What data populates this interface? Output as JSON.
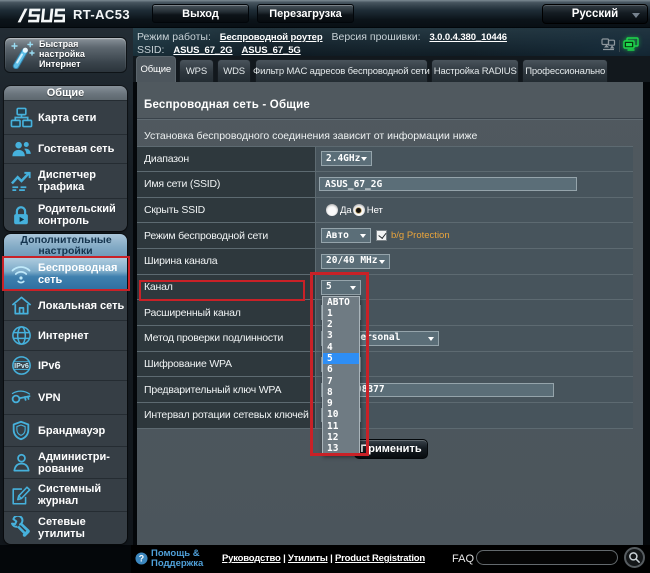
{
  "topbar": {
    "brand": "ASUS",
    "model": "RT-AC53",
    "logout_label": "Выход",
    "reboot_label": "Перезагрузка",
    "language": {
      "value": "Русский"
    }
  },
  "infobar": {
    "mode_label": "Режим работы:",
    "mode_link": "Беспроводной роутер",
    "firmware_label": "Версия прошивки:",
    "firmware_link": "3.0.0.4.380_10446",
    "ssid_label": "SSID:",
    "ssid_links": [
      "ASUS_67_2G",
      "ASUS_67_5G"
    ],
    "icons": [
      "clients-icon",
      "network-status-icon"
    ]
  },
  "tabs": [
    {
      "label": "Общие",
      "active": true
    },
    {
      "label": "WPS",
      "active": false
    },
    {
      "label": "WDS",
      "active": false
    },
    {
      "label": "Фильтр MAC адресов беспроводной сети",
      "active": false
    },
    {
      "label": "Настройка RADIUS",
      "active": false
    },
    {
      "label": "Профессионально",
      "active": false
    }
  ],
  "sidebar": {
    "qis_label_line1": "Быстрая",
    "qis_label_line2": "настройка",
    "qis_label_line3": "Интернет",
    "sections": [
      {
        "title": "Общие",
        "items": [
          {
            "label": "Карта сети",
            "icon": "network-map-icon"
          },
          {
            "label": "Гостевая сеть",
            "icon": "guest-network-icon"
          },
          {
            "label": "Диспетчер трафика",
            "icon": "traffic-manager-icon"
          },
          {
            "label": "Родительский контроль",
            "icon": "parental-control-icon"
          }
        ]
      },
      {
        "title": "Дополнительные настройки",
        "items": [
          {
            "label": "Беспроводная сеть",
            "icon": "wireless-icon",
            "active": true
          },
          {
            "label": "Локальная сеть",
            "icon": "lan-icon"
          },
          {
            "label": "Интернет",
            "icon": "wan-icon"
          },
          {
            "label": "IPv6",
            "icon": "ipv6-icon"
          },
          {
            "label": "VPN",
            "icon": "vpn-icon"
          },
          {
            "label": "Брандмауэр",
            "icon": "firewall-icon"
          },
          {
            "label": "Администри-рование",
            "icon": "administration-icon"
          },
          {
            "label": "Системный журнал",
            "icon": "system-log-icon"
          },
          {
            "label": "Сетевые утилиты",
            "icon": "network-tools-icon"
          }
        ]
      }
    ]
  },
  "page": {
    "title": "Беспроводная сеть - Общие",
    "description": "Установка беспроводного соединения зависит от информации ниже",
    "apply_label": "Применить"
  },
  "form": {
    "rows": [
      {
        "label": "Диапазон",
        "control": "select",
        "value": "2.4GHz"
      },
      {
        "label": "Имя сети (SSID)",
        "control": "input",
        "value": "ASUS_67_2G"
      },
      {
        "label": "Скрыть SSID",
        "control": "radio-group",
        "options": [
          "Да",
          "Нет"
        ],
        "selected": "Нет"
      },
      {
        "label": "Режим беспроводной сети",
        "control": "select",
        "value": "Авто",
        "checkbox_label": "b/g Protection",
        "checkbox_checked": true
      },
      {
        "label": "Ширина канала",
        "control": "select",
        "value": "20/40 MHz"
      },
      {
        "label": "Канал",
        "control": "select",
        "value": "5",
        "open": true
      },
      {
        "label": "Расширенный канал",
        "control": "select",
        "value": ""
      },
      {
        "label": "Метод проверки подлинности",
        "control": "select",
        "value": "WPA2-Personal"
      },
      {
        "label": "Шифрование WPA",
        "control": "select",
        "value": ""
      },
      {
        "label": "Предварительный ключ WPA",
        "control": "input",
        "value": "08377"
      },
      {
        "label": "Интервал ротации сетевых ключей",
        "control": "input",
        "value": ""
      }
    ]
  },
  "channel_dropdown": {
    "options": [
      "АВТО",
      "1",
      "2",
      "3",
      "4",
      "5",
      "6",
      "7",
      "8",
      "9",
      "10",
      "11",
      "12",
      "13"
    ],
    "selected": "5",
    "highlight_color": "#2e8ef5"
  },
  "annotations": {
    "color": "#c92127",
    "boxes": [
      "channel-label-highlight",
      "channel-dropdown-highlight"
    ]
  },
  "footer": {
    "help_line1": "Помощь &",
    "help_line2": "Поддержка",
    "links": [
      "Руководство",
      "Утилиты",
      "Product Registration"
    ],
    "link_separator": "|",
    "faq_label": "FAQ",
    "search_value": ""
  }
}
